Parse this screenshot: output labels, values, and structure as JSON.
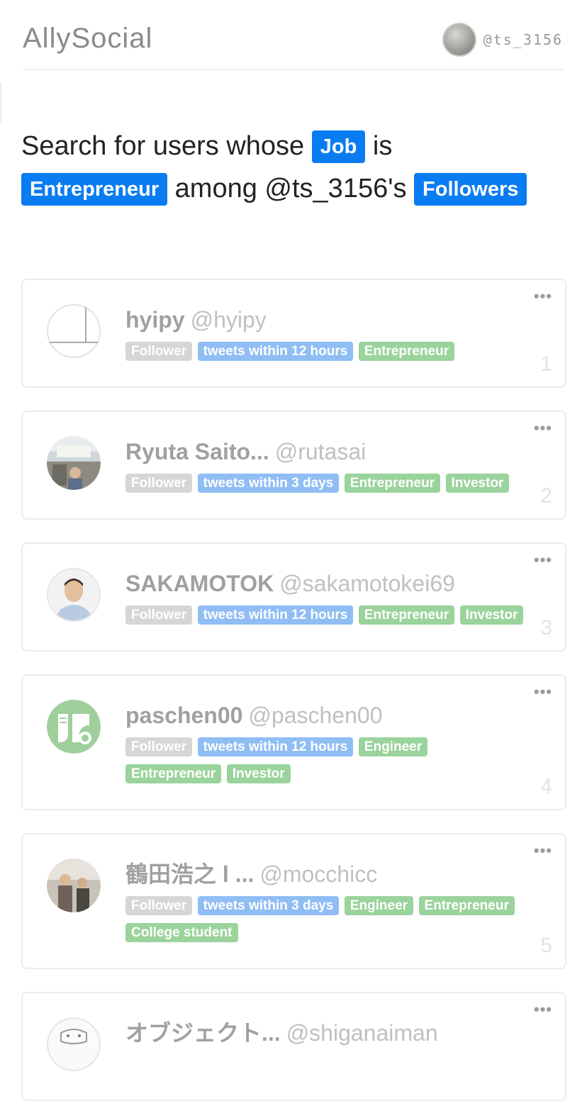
{
  "header": {
    "logo": "AllySocial",
    "user_handle": "@ts_3156"
  },
  "query": {
    "part1": "Search for users whose ",
    "chip_job": "Job",
    "part2": " is",
    "chip_value": "Entrepreneur",
    "part3": " among @ts_3156's ",
    "chip_scope": "Followers"
  },
  "results": [
    {
      "name": "hyipy",
      "handle": "@hyipy",
      "rank": "1",
      "avatar": "blank-avatar",
      "tags": [
        {
          "label": "Follower",
          "kind": "rel"
        },
        {
          "label": "tweets within 12 hours",
          "kind": "act"
        },
        {
          "label": "Entrepreneur",
          "kind": "attr"
        }
      ]
    },
    {
      "name": "Ryuta Saito...",
      "handle": "@rutasai",
      "rank": "2",
      "avatar": "shop-photo-avatar",
      "tags": [
        {
          "label": "Follower",
          "kind": "rel"
        },
        {
          "label": "tweets within 3 days",
          "kind": "act"
        },
        {
          "label": "Entrepreneur",
          "kind": "attr"
        },
        {
          "label": "Investor",
          "kind": "attr"
        }
      ]
    },
    {
      "name": "SAKAMOTOK",
      "handle": "@sakamotokei69",
      "rank": "3",
      "avatar": "portrait-avatar",
      "tags": [
        {
          "label": "Follower",
          "kind": "rel"
        },
        {
          "label": "tweets within 12 hours",
          "kind": "act"
        },
        {
          "label": "Entrepreneur",
          "kind": "attr"
        },
        {
          "label": "Investor",
          "kind": "attr"
        }
      ]
    },
    {
      "name": "paschen00",
      "handle": "@paschen00",
      "rank": "4",
      "avatar": "green-logo-avatar",
      "tags": [
        {
          "label": "Follower",
          "kind": "rel"
        },
        {
          "label": "tweets within 12 hours",
          "kind": "act"
        },
        {
          "label": "Engineer",
          "kind": "attr"
        },
        {
          "label": "Entrepreneur",
          "kind": "attr"
        },
        {
          "label": "Investor",
          "kind": "attr"
        }
      ]
    },
    {
      "name": "鶴田浩之 l ...",
      "handle": "@mocchicc",
      "rank": "5",
      "avatar": "group-photo-avatar",
      "tags": [
        {
          "label": "Follower",
          "kind": "rel"
        },
        {
          "label": "tweets within 3 days",
          "kind": "act"
        },
        {
          "label": "Engineer",
          "kind": "attr"
        },
        {
          "label": "Entrepreneur",
          "kind": "attr"
        },
        {
          "label": "College student",
          "kind": "attr"
        }
      ]
    },
    {
      "name": "オブジェクト...",
      "handle": "@shiganaiman",
      "rank": "",
      "avatar": "sketch-avatar",
      "tags": []
    }
  ],
  "more_icon": "•••",
  "colors": {
    "accent": "#0a7cf2",
    "tag_relationship": "#d6d6d6",
    "tag_activity": "#8fbdf4",
    "tag_attribute": "#9ad39c"
  }
}
